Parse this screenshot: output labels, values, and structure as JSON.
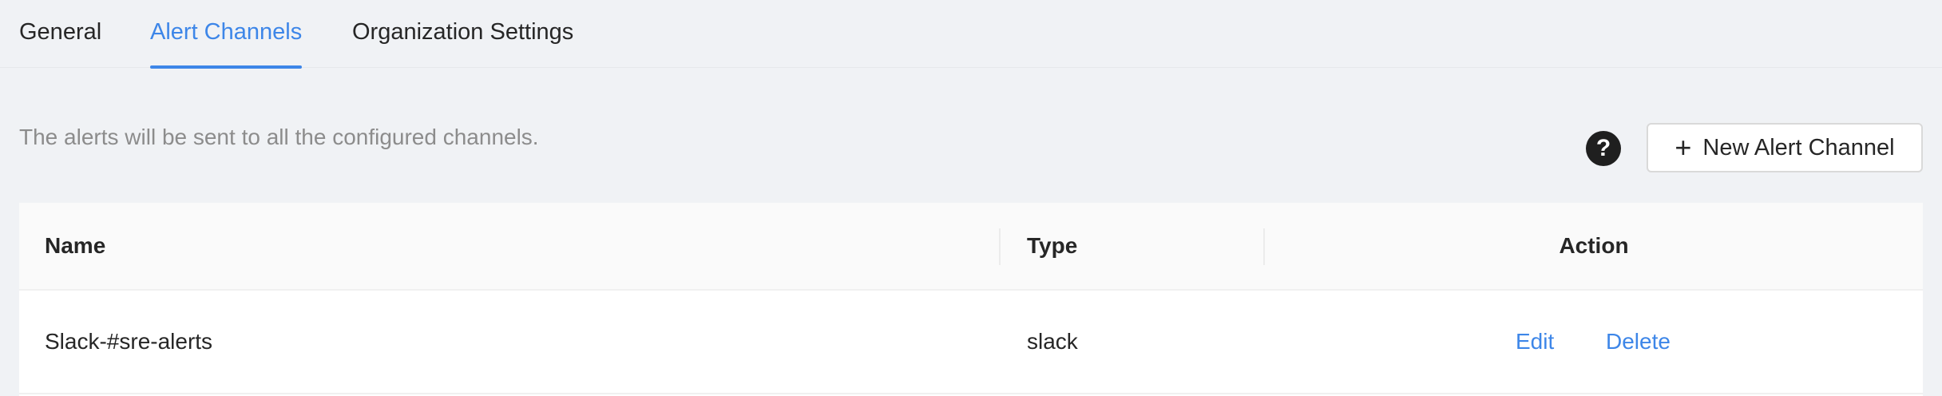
{
  "tabs": [
    {
      "label": "General",
      "active": false
    },
    {
      "label": "Alert Channels",
      "active": true
    },
    {
      "label": "Organization Settings",
      "active": false
    }
  ],
  "description": "The alerts will be sent to all the configured channels.",
  "help_icon": {
    "glyph": "?",
    "icon": "question-circle-icon"
  },
  "new_button": {
    "icon": "plus-icon",
    "glyph": "+",
    "label": "New Alert Channel"
  },
  "table": {
    "columns": [
      "Name",
      "Type",
      "Action"
    ],
    "rows": [
      {
        "name": "Slack-#sre-alerts",
        "type": "slack",
        "actions": [
          "Edit",
          "Delete"
        ]
      }
    ]
  },
  "colors": {
    "accent": "#3d86e8",
    "background": "#f0f2f5",
    "text": "#262626",
    "muted_text": "#8c8c8c"
  }
}
